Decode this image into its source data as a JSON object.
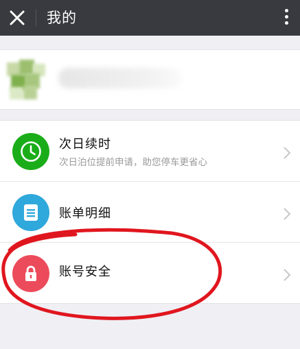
{
  "header": {
    "title": "我的"
  },
  "menu": [
    {
      "label": "次日续时",
      "sub": "次日泊位提前申请，助您停车更省心",
      "icon": "clock-icon",
      "color": "#1aad19"
    },
    {
      "label": "账单明细",
      "icon": "list-icon",
      "color": "#2fa8dc"
    },
    {
      "label": "账号安全",
      "icon": "lock-icon",
      "color": "#ec4b5b"
    }
  ],
  "colors": {
    "titlebar": "#393a3f",
    "background": "#efeff4",
    "annotation": "#e0161e"
  }
}
